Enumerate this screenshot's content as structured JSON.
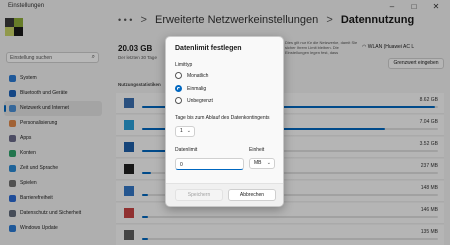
{
  "window": {
    "title": "Einstellungen",
    "minimize": "–",
    "maximize": "□",
    "close": "✕"
  },
  "sidebar": {
    "search_placeholder": "Einstellung suchen",
    "search_icon": "search-icon",
    "items": [
      {
        "label": "System",
        "icon": "monitor-icon",
        "color": "#2a7ad4"
      },
      {
        "label": "Bluetooth und Geräte",
        "icon": "bluetooth-icon",
        "color": "#1c62b9"
      },
      {
        "label": "Netzwerk und Internet",
        "icon": "wifi-icon",
        "color": "#4a8fd6",
        "active": true
      },
      {
        "label": "Personalisierung",
        "icon": "brush-icon",
        "color": "#e0884a"
      },
      {
        "label": "Apps",
        "icon": "apps-icon",
        "color": "#6a6a8a"
      },
      {
        "label": "Konten",
        "icon": "person-icon",
        "color": "#2fa36b"
      },
      {
        "label": "Zeit und Sprache",
        "icon": "globe-clock-icon",
        "color": "#2a8ad4"
      },
      {
        "label": "Spielen",
        "icon": "gamepad-icon",
        "color": "#707070"
      },
      {
        "label": "Barrierefreiheit",
        "icon": "accessibility-icon",
        "color": "#2a6ad4"
      },
      {
        "label": "Datenschutz und Sicherheit",
        "icon": "shield-icon",
        "color": "#606a7a"
      },
      {
        "label": "Windows Update",
        "icon": "update-icon",
        "color": "#2a7ad4"
      }
    ]
  },
  "header": {
    "dots": "• • •",
    "sep": ">",
    "parent": "Erweiterte Netzwerkeinstellungen",
    "current": "Datennutzung"
  },
  "summary": {
    "total": "20.03 GB",
    "subtitle": "Der letzten 30 Tage"
  },
  "right_info": "Dies gilt nur für die Netzwerke, damit Sie sicher Ihrem Limit bleiben. Die Einstellungen legen fest, dass",
  "network": {
    "icon": "wifi-icon",
    "name": "WLAN (Huawei AC L"
  },
  "limit_button": "Grenzwert eingeben",
  "stats_title": "Nutzungsstatistiken",
  "usage": [
    {
      "amount": "8.62 GB",
      "fraction": 0.99,
      "icon_color": "#3b6fb0"
    },
    {
      "amount": "7.04 GB",
      "fraction": 0.82,
      "icon_color": "#2aa0d8"
    },
    {
      "amount": "3.52 GB",
      "fraction": 0.41,
      "icon_color": "#1e5fa8"
    },
    {
      "amount": "237 MB",
      "fraction": 0.03,
      "icon_color": "#202020"
    },
    {
      "amount": "148 MB",
      "fraction": 0.02,
      "icon_color": "#3478c6"
    },
    {
      "amount": "146 MB",
      "fraction": 0.02,
      "icon_color": "#c84545"
    },
    {
      "amount": "135 MB",
      "fraction": 0.02,
      "icon_color": "#606060"
    }
  ],
  "dialog": {
    "title": "Datenlimit festlegen",
    "type_label": "Limittyp",
    "options": [
      {
        "label": "Monatlich",
        "checked": false
      },
      {
        "label": "Einmalig",
        "checked": true
      },
      {
        "label": "Unbegrenzt",
        "checked": false
      }
    ],
    "days_label": "Tage bis zum Ablauf des Datenkontingents",
    "days_value": "1",
    "limit_label": "Datenlimit",
    "limit_value": "0",
    "unit_label": "Einheit",
    "unit_value": "MB",
    "chevron": "⌄",
    "save_label": "Speichern",
    "cancel_label": "Abbrechen"
  }
}
